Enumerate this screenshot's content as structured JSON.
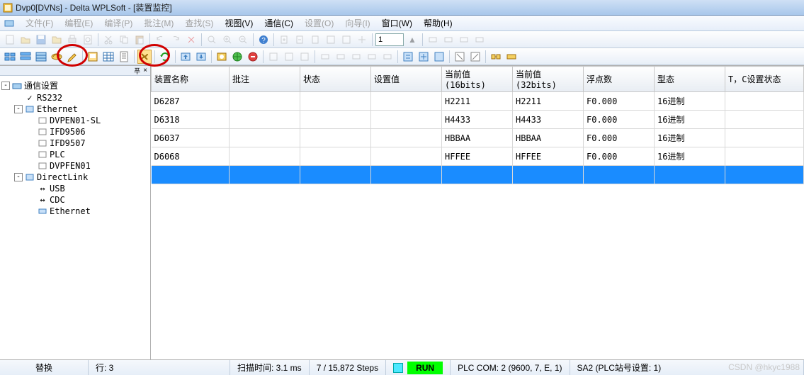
{
  "title": "Dvp0[DVNs] - Delta WPLSoft - [装置监控]",
  "menu": {
    "file": "文件(F)",
    "prog": "编程(E)",
    "comp": "编译(P)",
    "batch": "批注(M)",
    "search": "查找(S)",
    "view": "视图(V)",
    "comm": "通信(C)",
    "setup": "设置(O)",
    "wizard": "向导(I)",
    "window": "窗口(W)",
    "help": "帮助(H)"
  },
  "toolbar_spin": "1",
  "tree": {
    "root": "通信设置",
    "items": [
      {
        "label": "RS232"
      },
      {
        "label": "Ethernet",
        "children": [
          "DVPEN01-SL",
          "IFD9506",
          "IFD9507",
          "PLC",
          "DVPFEN01"
        ]
      },
      {
        "label": "DirectLink",
        "children": [
          "USB",
          "CDC",
          "Ethernet"
        ]
      }
    ]
  },
  "columns": [
    "装置名称",
    "批注",
    "状态",
    "设置值",
    "当前值 (16bits)",
    "当前值 (32bits)",
    "浮点数",
    "型态",
    "T，C设置状态"
  ],
  "rows": [
    {
      "name": "D6287",
      "note": "",
      "state": "",
      "setv": "",
      "v16": "H2211",
      "v32": "H2211",
      "flt": "F0.000",
      "type": "16进制",
      "tc": ""
    },
    {
      "name": "D6318",
      "note": "",
      "state": "",
      "setv": "",
      "v16": "H4433",
      "v32": "H4433",
      "flt": "F0.000",
      "type": "16进制",
      "tc": ""
    },
    {
      "name": "D6037",
      "note": "",
      "state": "",
      "setv": "",
      "v16": "HBBAA",
      "v32": "HBBAA",
      "flt": "F0.000",
      "type": "16进制",
      "tc": ""
    },
    {
      "name": "D6068",
      "note": "",
      "state": "",
      "setv": "",
      "v16": "HFFEE",
      "v32": "HFFEE",
      "flt": "F0.000",
      "type": "16进制",
      "tc": ""
    }
  ],
  "status": {
    "replace": "替换",
    "row": "行: 3",
    "scan": "扫描时间: 3.1 ms",
    "steps": "7 / 15,872 Steps",
    "run": "RUN",
    "plc_com": "PLC COM: 2 (9600, 7, E, 1)",
    "station": "SA2 (PLC站号设置: 1)"
  },
  "watermark": "CSDN @hkyc1988"
}
